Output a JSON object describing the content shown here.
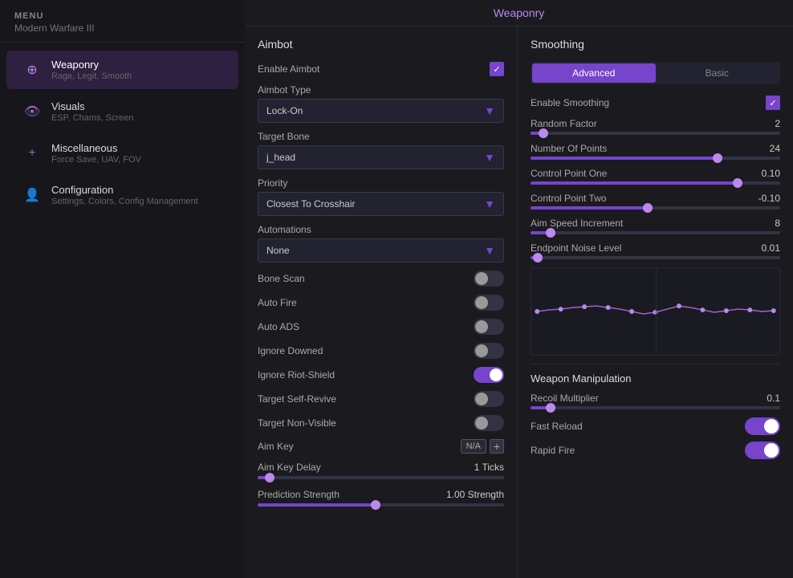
{
  "sidebar": {
    "menu_label": "MENU",
    "game_label": "Modern Warfare III",
    "items": [
      {
        "id": "weaponry",
        "title": "Weaponry",
        "sub": "Rage, Legit, Smooth",
        "active": true,
        "icon": "⊕"
      },
      {
        "id": "visuals",
        "title": "Visuals",
        "sub": "ESP, Chams, Screen",
        "active": false,
        "icon": "👁"
      },
      {
        "id": "miscellaneous",
        "title": "Miscellaneous",
        "sub": "Force Save, UAV, FOV",
        "active": false,
        "icon": "+"
      },
      {
        "id": "configuration",
        "title": "Configuration",
        "sub": "Settings, Colors, Config Management",
        "active": false,
        "icon": "👤"
      }
    ]
  },
  "main_title": "Weaponry",
  "aimbot": {
    "title": "Aimbot",
    "enable_label": "Enable Aimbot",
    "enable_checked": true,
    "type_label": "Aimbot Type",
    "type_value": "Lock-On",
    "bone_label": "Target Bone",
    "bone_value": "j_head",
    "priority_label": "Priority",
    "priority_value": "Closest To Crosshair",
    "automations_label": "Automations",
    "automations_value": "None",
    "toggles": [
      {
        "id": "bone-scan",
        "label": "Bone Scan",
        "on": false
      },
      {
        "id": "auto-fire",
        "label": "Auto Fire",
        "on": false
      },
      {
        "id": "auto-ads",
        "label": "Auto ADS",
        "on": false
      },
      {
        "id": "ignore-downed",
        "label": "Ignore Downed",
        "on": false
      },
      {
        "id": "ignore-riot-shield",
        "label": "Ignore Riot-Shield",
        "on": true
      },
      {
        "id": "target-self-revive",
        "label": "Target Self-Revive",
        "on": false
      },
      {
        "id": "target-non-visible",
        "label": "Target Non-Visible",
        "on": false
      }
    ],
    "aim_key_label": "Aim Key",
    "aim_key_value": "N/A",
    "aim_key_delay_label": "Aim Key Delay",
    "aim_key_delay_value": "1 Ticks",
    "aim_key_delay_pct": 5,
    "prediction_label": "Prediction Strength",
    "prediction_value": "1.00 Strength",
    "prediction_pct": 48
  },
  "smoothing": {
    "title": "Smoothing",
    "tab_advanced": "Advanced",
    "tab_basic": "Basic",
    "enable_label": "Enable Smoothing",
    "enable_checked": true,
    "sliders": [
      {
        "id": "random-factor",
        "label": "Random Factor",
        "value": "2",
        "pct": 5
      },
      {
        "id": "number-of-points",
        "label": "Number Of Points",
        "value": "24",
        "pct": 75
      },
      {
        "id": "control-point-one",
        "label": "Control Point One",
        "value": "0.10",
        "pct": 83
      },
      {
        "id": "control-point-two",
        "label": "Control Point Two",
        "value": "-0.10",
        "pct": 47
      },
      {
        "id": "aim-speed-increment",
        "label": "Aim Speed Increment",
        "value": "8",
        "pct": 8
      },
      {
        "id": "endpoint-noise-level",
        "label": "Endpoint Noise Level",
        "value": "0.01",
        "pct": 3
      }
    ],
    "weapon_manipulation": {
      "title": "Weapon Manipulation",
      "recoil_label": "Recoil Multiplier",
      "recoil_value": "0.1",
      "recoil_pct": 8,
      "fast_reload_label": "Fast Reload",
      "fast_reload_on": true,
      "rapid_fire_label": "Rapid Fire",
      "rapid_fire_on": true
    }
  }
}
